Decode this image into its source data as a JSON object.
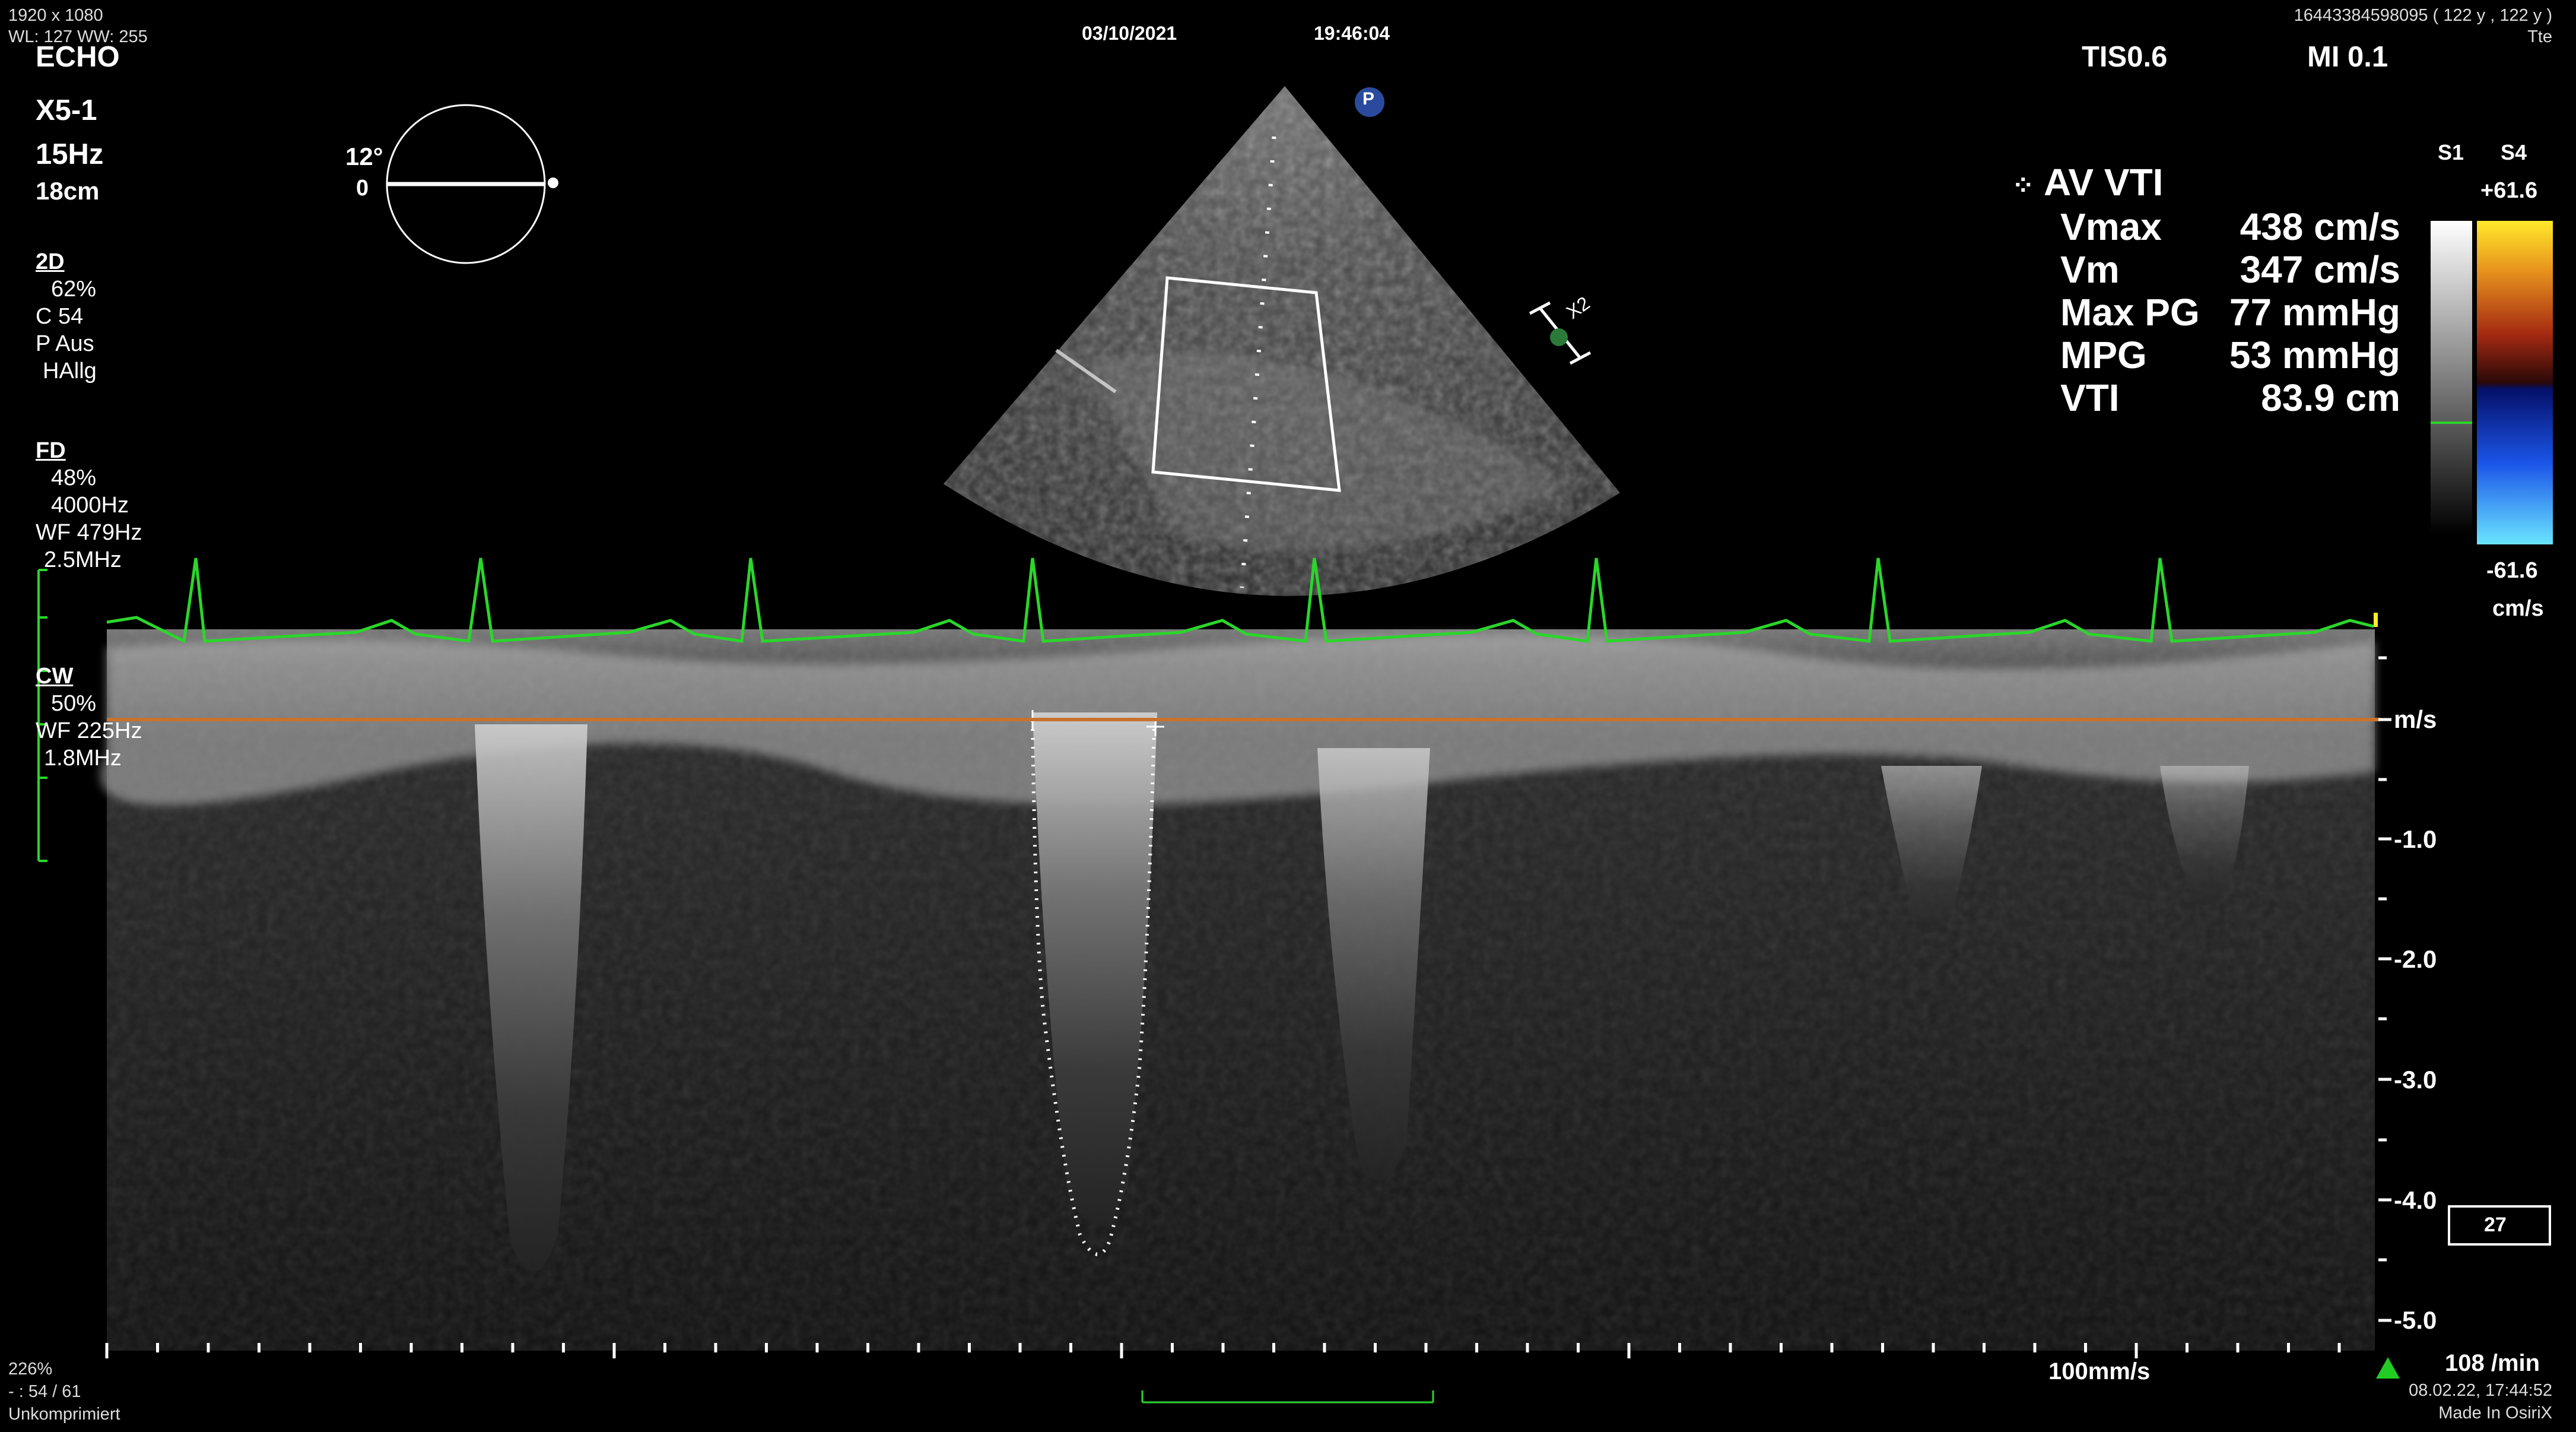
{
  "top_left": {
    "resolution": "1920 x 1080",
    "window_level": "WL: 127 WW: 255"
  },
  "header": {
    "date": "03/10/2021",
    "time": "19:46:04",
    "patient_info": "16443384598095 ( 122 y , 122 y )",
    "study_type": "Tte",
    "tis": "TIS0.6",
    "mi": "MI 0.1"
  },
  "left_params": {
    "mode": "ECHO",
    "probe": "X5-1",
    "frame_rate": "15Hz",
    "depth": "18cm",
    "angle": "12°",
    "angle_zero": "0",
    "twod": {
      "title": "2D",
      "lines": [
        "62%",
        "C 54",
        "P Aus",
        "HAllg"
      ]
    },
    "fd": {
      "title": "FD",
      "lines": [
        "48%",
        "4000Hz",
        "WF 479Hz",
        "2.5MHz"
      ]
    },
    "cw": {
      "title": "CW",
      "lines": [
        "50%",
        "WF 225Hz",
        "1.8MHz"
      ]
    }
  },
  "measurement": {
    "title": "AV VTI",
    "rows": [
      {
        "label": "Vmax",
        "value": "438 cm/s"
      },
      {
        "label": "Vm",
        "value": "347 cm/s"
      },
      {
        "label": "Max PG",
        "value": "77 mmHg"
      },
      {
        "label": "MPG",
        "value": "53 mmHg"
      },
      {
        "label": "VTI",
        "value": "83.9 cm"
      }
    ]
  },
  "color_bar": {
    "s1": "S1",
    "s4": "S4",
    "max": "+61.6",
    "min": "-61.6",
    "unit": "cm/s"
  },
  "velocity_axis": {
    "unit": "m/s",
    "ticks": [
      "-1.0",
      "-2.0",
      "-3.0",
      "-4.0",
      "-5.0"
    ]
  },
  "x2_label": "X2",
  "probe_marker": "P",
  "frame_box": "27",
  "bottom": {
    "zoom": "226%",
    "frame": "- : 54 / 61",
    "compression": "Unkomprimiert",
    "sweep": "100mm/s",
    "heart_rate": "108 /min",
    "datetime": "08.02.22, 17:44:52",
    "made_in": "Made In OsiriX"
  },
  "colors": {
    "ecg": "#2bd62b",
    "baseline": "#c8722e",
    "accent_green": "#22cc22"
  }
}
